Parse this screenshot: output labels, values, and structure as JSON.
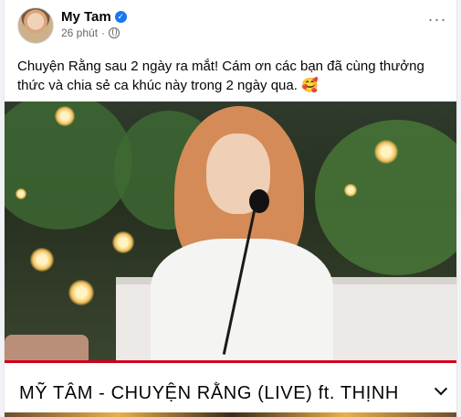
{
  "post": {
    "author": "My Tam",
    "time": "26 phút",
    "separator": "·",
    "more_label": "···",
    "verified_badge": "✓",
    "text": "Chuyện Rằng sau 2 ngày ra mắt! Cám ơn các bạn đã cùng thưởng thức và chia sẻ ca khúc này trong 2 ngày qua. 🥰"
  },
  "video": {
    "title": "MỸ TÂM - CHUYỆN RẰNG (LIVE) ft. THỊNH",
    "progress_color": "#d0021b"
  },
  "colors": {
    "verified": "#1877f2",
    "secondary_text": "#65676b"
  },
  "icons": [
    "verified-icon",
    "globe-icon",
    "more-icon",
    "chevron-down-icon"
  ]
}
